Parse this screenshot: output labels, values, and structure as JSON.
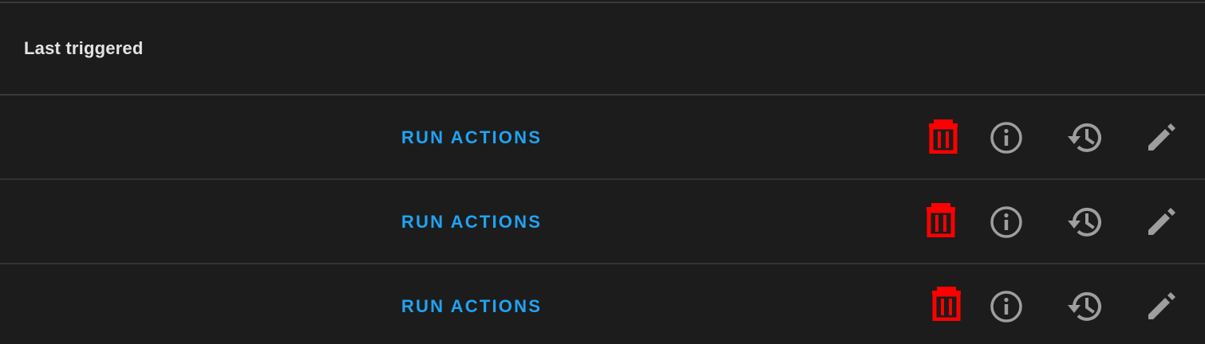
{
  "table": {
    "header": {
      "label": "Last triggered"
    },
    "rows": [
      {
        "run_label": "RUN ACTIONS",
        "icons": [
          "trash-icon",
          "info-icon",
          "history-icon",
          "pencil-icon"
        ]
      },
      {
        "run_label": "RUN ACTIONS",
        "icons": [
          "trash-icon",
          "info-icon",
          "history-icon",
          "pencil-icon"
        ]
      },
      {
        "run_label": "RUN ACTIONS",
        "icons": [
          "trash-icon",
          "info-icon",
          "history-icon",
          "pencil-icon"
        ]
      }
    ]
  },
  "colors": {
    "background": "#1c1c1c",
    "accent_link": "#21a3f1",
    "delete_icon": "#ff0000",
    "icon_gray": "#9e9e9e",
    "divider": "#3a3a3a",
    "header_text": "#e3e3e3"
  }
}
